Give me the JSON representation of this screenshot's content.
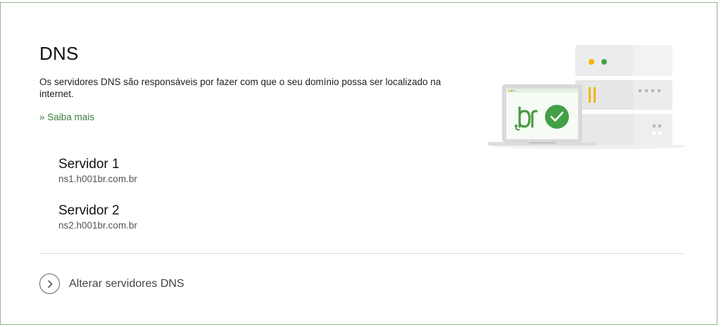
{
  "dns": {
    "title": "DNS",
    "description": "Os servidores DNS são responsáveis por fazer com que o seu domínio possa ser localizado na internet.",
    "learn_more": "» Saiba mais"
  },
  "servers": [
    {
      "label": "Servidor 1",
      "host": "ns1.h001br.com.br"
    },
    {
      "label": "Servidor 2",
      "host": "ns2.h001br.com.br"
    }
  ],
  "actions": {
    "change_dns": "Alterar servidores DNS",
    "change_icon": "chevron-right-icon"
  },
  "illustration": {
    "screen_text": ".br",
    "icon": "check-icon",
    "colors": {
      "brand_green": "#4a9a3f",
      "check_green": "#43a047",
      "light_green": "#c8e6c4",
      "amber": "#f4b400",
      "server_gray": "#e8e8e8"
    }
  },
  "colors": {
    "border": "#8fb98a",
    "link": "#3d7d3a",
    "text": "#222222"
  }
}
